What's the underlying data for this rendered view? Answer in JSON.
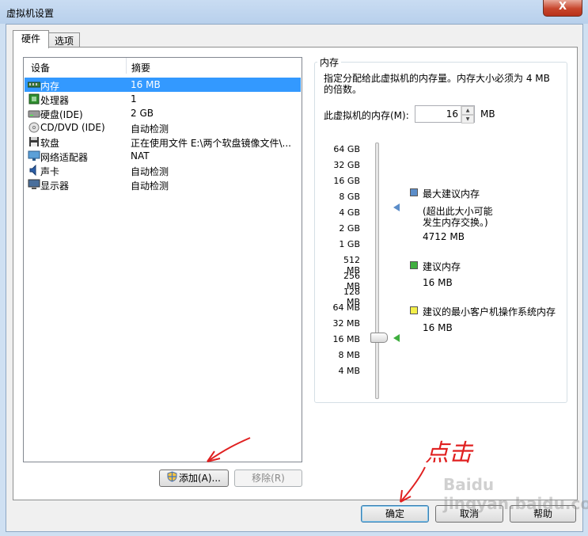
{
  "window": {
    "title": "虚拟机设置",
    "close_glyph": "X"
  },
  "tabs": [
    {
      "label": "硬件",
      "active": true
    },
    {
      "label": "选项",
      "active": false
    }
  ],
  "device_list": {
    "columns": [
      "设备",
      "摘要"
    ],
    "rows": [
      {
        "icon": "memory-icon",
        "name": "内存",
        "summary": "16 MB",
        "selected": true
      },
      {
        "icon": "processor-icon",
        "name": "处理器",
        "summary": "1"
      },
      {
        "icon": "harddisk-icon",
        "name": "硬盘(IDE)",
        "summary": "2 GB"
      },
      {
        "icon": "cd-dvd-icon",
        "name": "CD/DVD (IDE)",
        "summary": "自动检测"
      },
      {
        "icon": "floppy-icon",
        "name": "软盘",
        "summary": "正在使用文件 E:\\两个软盘镜像文件\\..."
      },
      {
        "icon": "network-icon",
        "name": "网络适配器",
        "summary": "NAT"
      },
      {
        "icon": "sound-icon",
        "name": "声卡",
        "summary": "自动检测"
      },
      {
        "icon": "display-icon",
        "name": "显示器",
        "summary": "自动检测"
      }
    ]
  },
  "buttons": {
    "add": "添加(A)...",
    "remove": "移除(R)",
    "ok": "确定",
    "cancel": "取消",
    "help": "帮助"
  },
  "memory": {
    "group_title": "内存",
    "description": "指定分配给此虚拟机的内存量。内存大小必须为 4 MB 的倍数。",
    "label": "此虚拟机的内存(M):",
    "value": "16",
    "unit": "MB",
    "scale": [
      "64 GB",
      "32 GB",
      "16 GB",
      "8 GB",
      "4 GB",
      "2 GB",
      "1 GB",
      "512 MB",
      "256 MB",
      "128 MB",
      "64 MB",
      "32 MB",
      "16 MB",
      "8 MB",
      "4 MB"
    ],
    "legend": {
      "max": {
        "title": "最大建议内存",
        "note1": "(超出此大小可能",
        "note2": "发生内存交换。)",
        "value": "4712 MB",
        "color": "#5b8dc9"
      },
      "recommended": {
        "title": "建议内存",
        "value": "16 MB",
        "color": "#3fae3f"
      },
      "min": {
        "title": "建议的最小客户机操作系统内存",
        "value": "16 MB",
        "color": "#f3ef4a"
      }
    }
  },
  "annotation": {
    "handwritten": "点击"
  },
  "watermark": "Baidu jingyan.baidu.com"
}
